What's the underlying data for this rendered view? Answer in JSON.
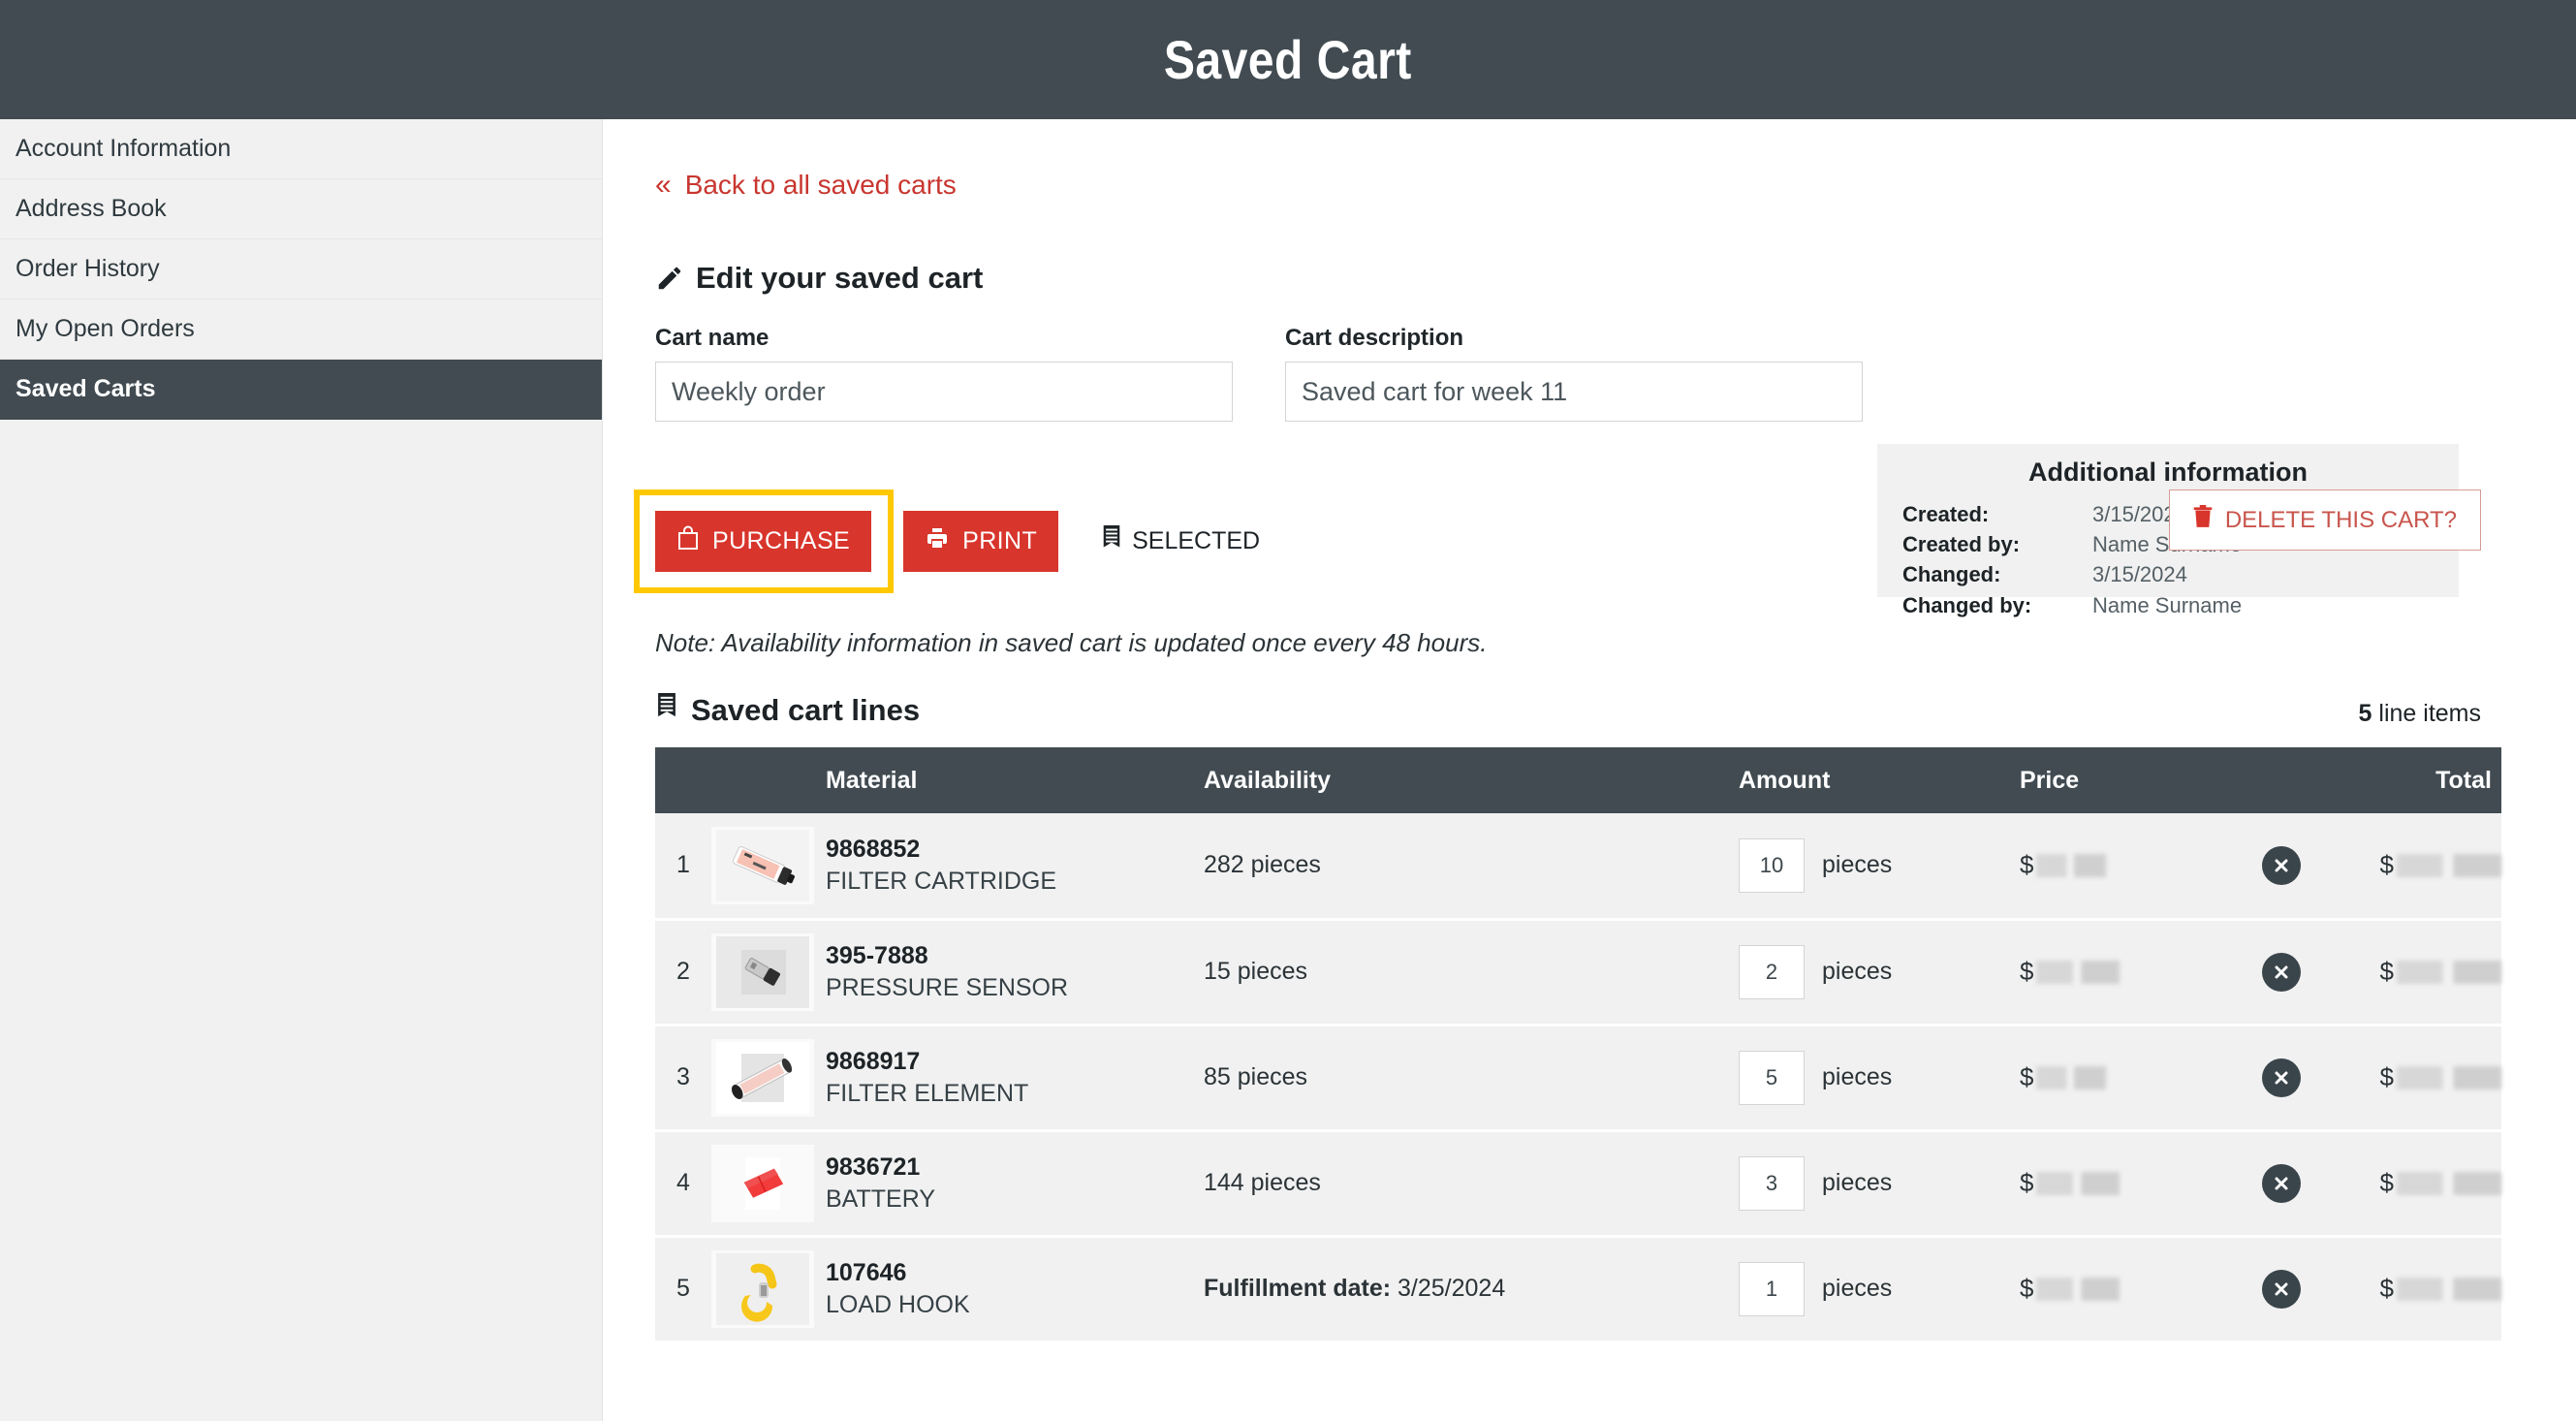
{
  "header": {
    "title": "Saved Cart"
  },
  "sidebar": {
    "items": [
      {
        "label": "Account Information",
        "active": false
      },
      {
        "label": "Address Book",
        "active": false
      },
      {
        "label": "Order History",
        "active": false
      },
      {
        "label": "My Open Orders",
        "active": false
      },
      {
        "label": "Saved Carts",
        "active": true
      }
    ]
  },
  "back_link": {
    "chevron": "«",
    "label": "Back to all saved carts"
  },
  "edit_section": {
    "icon": "pencil-icon",
    "title": "Edit your saved cart",
    "cart_name": {
      "label": "Cart name",
      "value": "Weekly order",
      "placeholder": "Cart name"
    },
    "cart_description": {
      "label": "Cart description",
      "value": "Saved cart for week 11",
      "placeholder": "Cart description"
    }
  },
  "additional_information": {
    "title": "Additional information",
    "rows": [
      {
        "key": "Created:",
        "value": "3/15/2024"
      },
      {
        "key": "Created by:",
        "value": "Name Surname"
      },
      {
        "key": "Changed:",
        "value": "3/15/2024"
      },
      {
        "key": "Changed by:",
        "value": "Name Surname"
      }
    ]
  },
  "actions": {
    "purchase_label": "PURCHASE",
    "purchase_icon": "shopping-bag-icon",
    "purchase_highlight_color": "#ffc800",
    "print_label": "PRINT",
    "print_icon": "printer-icon",
    "selected_label": "SELECTED",
    "selected_icon": "list-lines-icon",
    "delete_label": "DELETE THIS CART?",
    "delete_icon": "trash-icon",
    "accent_red": "#d8352c"
  },
  "note": "Note: Availability information in saved cart is updated once every 48 hours.",
  "lines_section": {
    "icon": "list-lines-icon",
    "title": "Saved cart lines",
    "count_number": "5",
    "count_suffix": " line items"
  },
  "table": {
    "columns": [
      "",
      "",
      "Material",
      "Availability",
      "Amount",
      "Price",
      "",
      "Total"
    ],
    "headers": {
      "material": "Material",
      "availability": "Availability",
      "amount": "Amount",
      "price": "Price",
      "total": "Total"
    },
    "unit_label": "pieces",
    "currency_symbol": "$",
    "rows": [
      {
        "index": "1",
        "thumb": "filter-cartridge-thumbnail",
        "material_number": "9868852",
        "material_name": "FILTER CARTRIDGE",
        "availability": "282 pieces",
        "availability_prefix": "",
        "amount": "10",
        "unit": "pieces",
        "price": "",
        "total": "",
        "remove_icon": "remove-circle-icon"
      },
      {
        "index": "2",
        "thumb": "pressure-sensor-thumbnail",
        "material_number": "395-7888",
        "material_name": "PRESSURE SENSOR",
        "availability": "15 pieces",
        "availability_prefix": "",
        "amount": "2",
        "unit": "pieces",
        "price": "",
        "total": "",
        "remove_icon": "remove-circle-icon"
      },
      {
        "index": "3",
        "thumb": "filter-element-thumbnail",
        "material_number": "9868917",
        "material_name": "FILTER ELEMENT",
        "availability": "85 pieces",
        "availability_prefix": "",
        "amount": "5",
        "unit": "pieces",
        "price": "",
        "total": "",
        "remove_icon": "remove-circle-icon"
      },
      {
        "index": "4",
        "thumb": "battery-thumbnail",
        "material_number": "9836721",
        "material_name": "BATTERY",
        "availability": "144 pieces",
        "availability_prefix": "",
        "amount": "3",
        "unit": "pieces",
        "price": "",
        "total": "",
        "remove_icon": "remove-circle-icon"
      },
      {
        "index": "5",
        "thumb": "load-hook-thumbnail",
        "material_number": "107646",
        "material_name": "LOAD HOOK",
        "availability": "3/25/2024",
        "availability_prefix": "Fulfillment date:",
        "amount": "1",
        "unit": "pieces",
        "price": "",
        "total": "",
        "remove_icon": "remove-circle-icon"
      }
    ]
  },
  "theme": {
    "dark": "#414b51",
    "red": "#d8352c",
    "link_red": "#c8362f",
    "highlight_yellow": "#ffc800",
    "sidebar_bg": "#f1f1f1",
    "row_bg": "#f1f1f1"
  }
}
